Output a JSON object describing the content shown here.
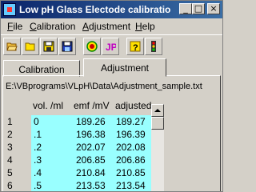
{
  "window": {
    "title": "Low pH Glass Electode calibration",
    "min_glyph": "_",
    "max_glyph": "□",
    "close_glyph": "×"
  },
  "menu": [
    {
      "label": "File",
      "u": "F",
      "rest": "ile"
    },
    {
      "label": "Calibration",
      "u": "C",
      "rest": "alibration"
    },
    {
      "label": "Adjustment",
      "u": "A",
      "rest": "djustment"
    },
    {
      "label": "Help",
      "u": "H",
      "rest": "elp"
    }
  ],
  "toolbar": {
    "icons": [
      "open-folder-icon",
      "open-folder-yellow-icon",
      "save-disk-yellow-icon",
      "save-disk-blue-icon",
      "target-icon",
      "jp-icon",
      "help-icon",
      "traffic-light-icon"
    ],
    "jp_text": "JP",
    "help_text": "?"
  },
  "tabs": {
    "calibration": "Calibration",
    "adjustment": "Adjustment"
  },
  "file_path": "E:\\VBprograms\\VLpH\\Data\\Adjustment_sample.txt",
  "table": {
    "headers": [
      "vol. /ml",
      "emf /mV",
      "adjusted"
    ],
    "rows": [
      {
        "n": "1",
        "vol": "0",
        "emf": "189.26",
        "adj": "189.27"
      },
      {
        "n": "2",
        "vol": ".1",
        "emf": "196.38",
        "adj": "196.39"
      },
      {
        "n": "3",
        "vol": ".2",
        "emf": "202.07",
        "adj": "202.08"
      },
      {
        "n": "4",
        "vol": ".3",
        "emf": "206.85",
        "adj": "206.86"
      },
      {
        "n": "5",
        "vol": ".4",
        "emf": "210.84",
        "adj": "210.85"
      },
      {
        "n": "6",
        "vol": ".5",
        "emf": "213.53",
        "adj": "213.54"
      }
    ]
  },
  "colors": {
    "titlebar": "#0a246a",
    "cell_bg": "#99ffff"
  }
}
